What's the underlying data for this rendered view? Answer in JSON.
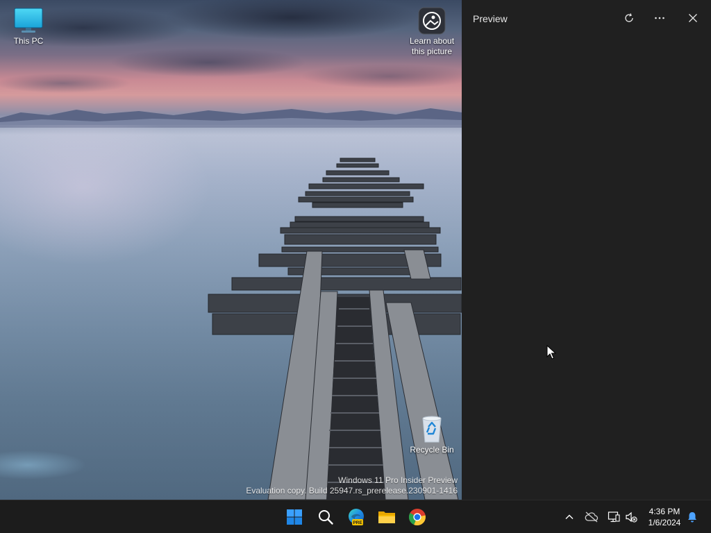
{
  "desktop": {
    "icons": {
      "this_pc": "This PC",
      "learn_about": "Learn about this picture",
      "recycle_bin": "Recycle Bin"
    },
    "watermark": {
      "line1": "Windows 11 Pro Insider Preview",
      "line2": "Evaluation copy. Build 25947.rs_prerelease.230901-1416"
    }
  },
  "preview_pane": {
    "title": "Preview",
    "buttons": [
      "refresh-icon",
      "more-options-icon",
      "close-icon"
    ]
  },
  "taskbar": {
    "apps": [
      "start-icon",
      "search-icon",
      "edge-pre-icon",
      "file-explorer-icon",
      "chrome-icon"
    ],
    "edge_badge": "PRE",
    "tray": [
      "show-hidden-icons-chevron",
      "onedrive-offline-icon",
      "network-icon",
      "volume-muted-icon",
      "notification-bell-icon"
    ],
    "clock": {
      "time": "4:36 PM",
      "date": "1/6/2024"
    }
  },
  "colors": {
    "pane_background": "#202020",
    "taskbar_background": "#1c1c1c",
    "accent_blue": "#0a84ff"
  }
}
